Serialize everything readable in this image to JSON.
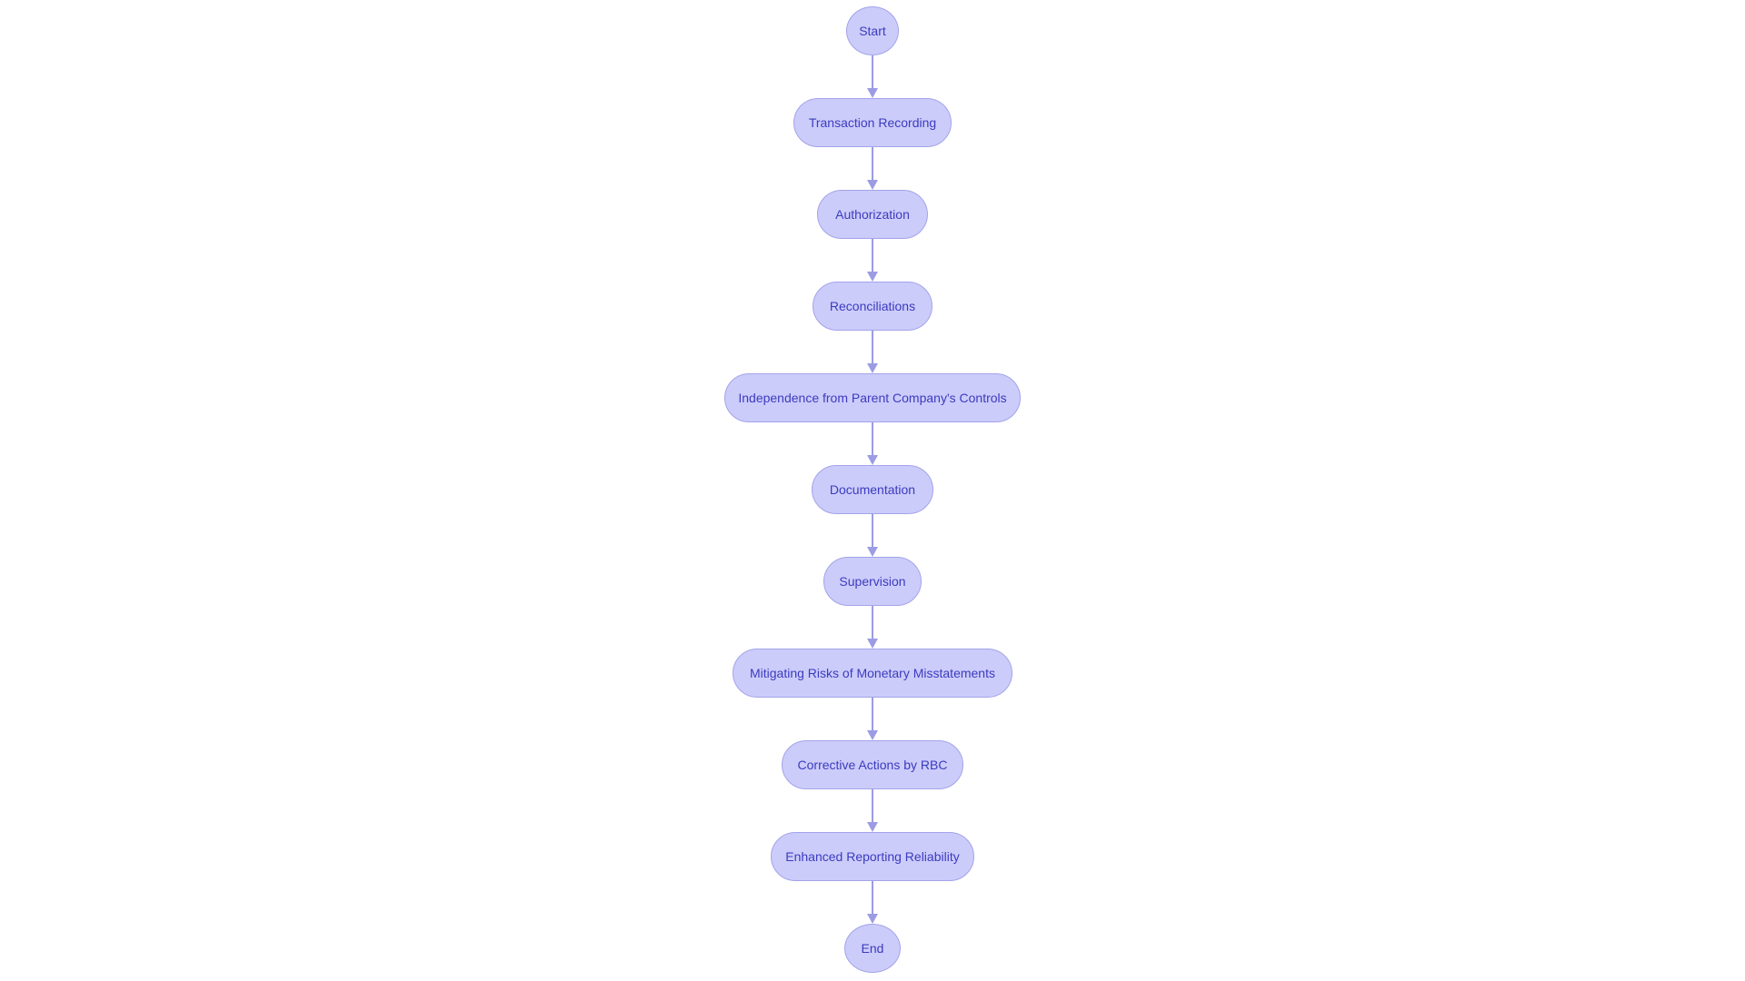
{
  "diagram": {
    "type": "flowchart",
    "direction": "top-to-bottom",
    "colors": {
      "node_fill": "#ccccfb",
      "node_stroke": "#a3a3ea",
      "text": "#3b3bbf",
      "edge": "#9c9ce4"
    },
    "nodes": [
      {
        "id": "start",
        "label": "Start",
        "shape": "circle"
      },
      {
        "id": "transaction-recording",
        "label": "Transaction Recording",
        "shape": "stadium"
      },
      {
        "id": "authorization",
        "label": "Authorization",
        "shape": "stadium"
      },
      {
        "id": "reconciliations",
        "label": "Reconciliations",
        "shape": "stadium"
      },
      {
        "id": "independence",
        "label": "Independence from Parent Company's Controls",
        "shape": "stadium"
      },
      {
        "id": "documentation",
        "label": "Documentation",
        "shape": "stadium"
      },
      {
        "id": "supervision",
        "label": "Supervision",
        "shape": "stadium"
      },
      {
        "id": "mitigating-risks",
        "label": "Mitigating Risks of Monetary Misstatements",
        "shape": "stadium"
      },
      {
        "id": "corrective-actions",
        "label": "Corrective Actions by RBC",
        "shape": "stadium"
      },
      {
        "id": "enhanced-reporting",
        "label": "Enhanced Reporting Reliability",
        "shape": "stadium"
      },
      {
        "id": "end",
        "label": "End",
        "shape": "circle"
      }
    ],
    "edges": [
      {
        "from": "start",
        "to": "transaction-recording"
      },
      {
        "from": "transaction-recording",
        "to": "authorization"
      },
      {
        "from": "authorization",
        "to": "reconciliations"
      },
      {
        "from": "reconciliations",
        "to": "independence"
      },
      {
        "from": "independence",
        "to": "documentation"
      },
      {
        "from": "documentation",
        "to": "supervision"
      },
      {
        "from": "supervision",
        "to": "mitigating-risks"
      },
      {
        "from": "mitigating-risks",
        "to": "corrective-actions"
      },
      {
        "from": "corrective-actions",
        "to": "enhanced-reporting"
      },
      {
        "from": "enhanced-reporting",
        "to": "end"
      }
    ]
  }
}
